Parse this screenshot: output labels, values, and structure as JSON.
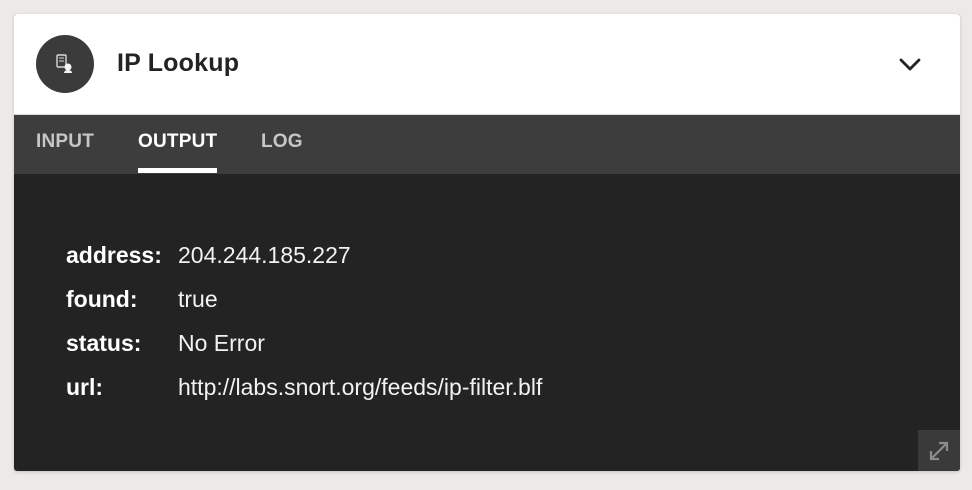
{
  "panel": {
    "title": "IP Lookup",
    "avatar_icon": "ip-lookup-icon",
    "collapse_icon": "chevron-down-icon",
    "expand_icon": "expand-icon"
  },
  "tabs": [
    {
      "label": "INPUT",
      "active": false
    },
    {
      "label": "OUTPUT",
      "active": true
    },
    {
      "label": "LOG",
      "active": false
    }
  ],
  "output": [
    {
      "key": "address:",
      "value": "204.244.185.227"
    },
    {
      "key": "found:",
      "value": "true"
    },
    {
      "key": "status:",
      "value": "No Error"
    },
    {
      "key": "url:",
      "value": "http://labs.snort.org/feeds/ip-filter.blf"
    }
  ],
  "colors": {
    "page_background": "#ebeae7",
    "header_background": "#ffffff",
    "tab_bar": "#3d3d3d",
    "content_background": "#232323",
    "active_tab": "#ffffff"
  }
}
